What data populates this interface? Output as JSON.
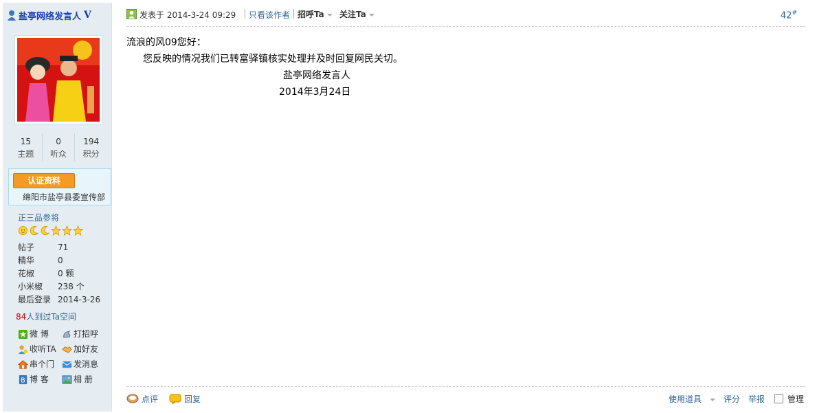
{
  "author": {
    "name": "盐亭网络发言人",
    "verified_mark": "V",
    "stats": [
      {
        "value": "15",
        "label": "主题"
      },
      {
        "value": "0",
        "label": "听众"
      },
      {
        "value": "194",
        "label": "积分"
      }
    ],
    "cert_button": "认证资料",
    "cert_org": "绵阳市盐亭县委宣传部",
    "rank": "正三品参将",
    "info": [
      {
        "key": "帖子",
        "value": "71"
      },
      {
        "key": "精华",
        "value": "0"
      },
      {
        "key": "花椒",
        "value": "0 颗"
      },
      {
        "key": "小米椒",
        "value": "238 个"
      },
      {
        "key": "最后登录",
        "value": "2014-3-26"
      }
    ],
    "visitors_count": "84",
    "visitors_text": "人到过Ta空间",
    "actions": {
      "weibo": "微 博",
      "greet": "打招呼",
      "listen": "收听TA",
      "add_friend": "加好友",
      "visit": "串个门",
      "message": "发消息",
      "blog": "博 客",
      "album": "相 册"
    }
  },
  "post": {
    "posted_at": "发表于 2014-3-24 09:29",
    "only_author": "只看该作者",
    "greet": "招呼Ta",
    "follow": "关注Ta",
    "floor": "42",
    "floor_mark": "#",
    "greeting_line": "流浪的风09您好：",
    "body_line": "您反映的情况我们已转富驿镇核实处理并及时回复网民关切。",
    "signature": "盐亭网络发言人",
    "date": "2014年3月24日"
  },
  "footer": {
    "comment": "点评",
    "reply": "回复",
    "use_tool": "使用道具",
    "rate": "评分",
    "report": "举报",
    "manage": "管理"
  }
}
